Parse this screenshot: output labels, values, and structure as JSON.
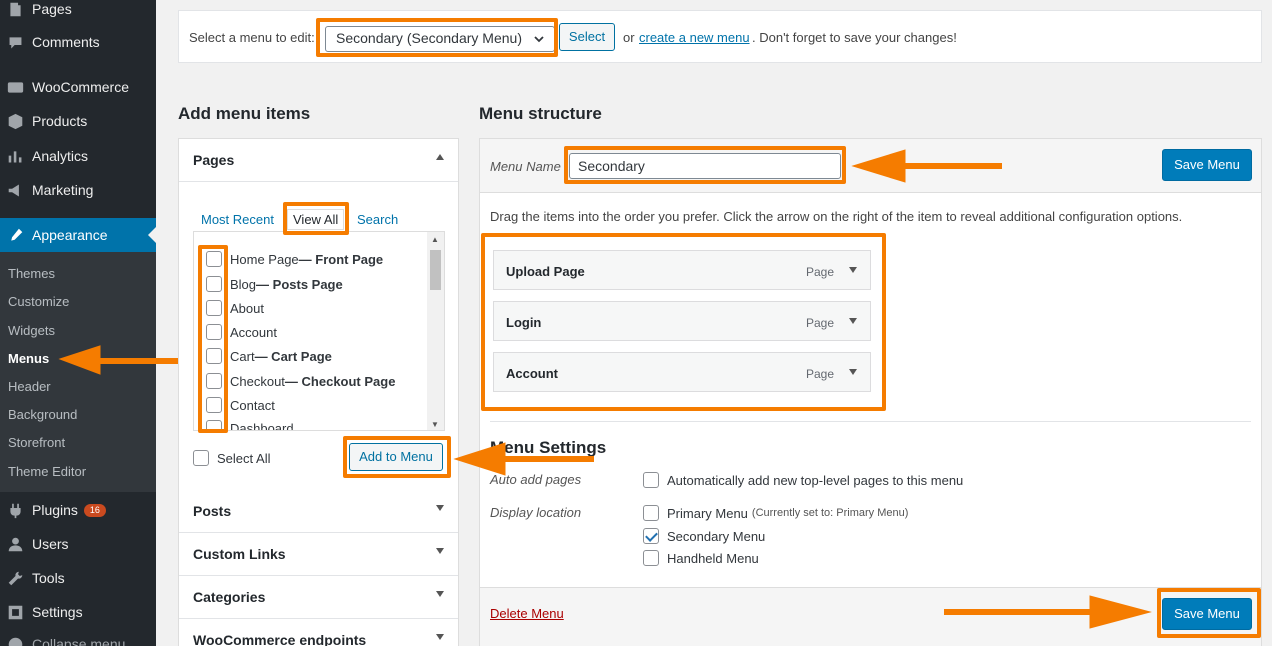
{
  "sidebar": {
    "items": [
      {
        "label": "Pages",
        "icon": "pages-icon"
      },
      {
        "label": "Comments",
        "icon": "comments-icon"
      },
      {
        "label": "WooCommerce",
        "icon": "woocommerce-icon"
      },
      {
        "label": "Products",
        "icon": "products-icon"
      },
      {
        "label": "Analytics",
        "icon": "analytics-icon"
      },
      {
        "label": "Marketing",
        "icon": "marketing-icon"
      },
      {
        "label": "Appearance",
        "icon": "appearance-icon"
      },
      {
        "label": "Plugins",
        "icon": "plugins-icon",
        "badge": "16"
      },
      {
        "label": "Users",
        "icon": "users-icon"
      },
      {
        "label": "Tools",
        "icon": "tools-icon"
      },
      {
        "label": "Settings",
        "icon": "settings-icon"
      },
      {
        "label": "Collapse menu",
        "icon": "collapse-icon"
      }
    ],
    "submenu": [
      "Themes",
      "Customize",
      "Widgets",
      "Menus",
      "Header",
      "Background",
      "Storefront",
      "Theme Editor"
    ]
  },
  "topbar": {
    "label": "Select a menu to edit:",
    "selected_menu": "Secondary (Secondary Menu)",
    "select_button": "Select",
    "or_text": "or",
    "create_link": "create a new menu",
    "rest_text": ". Don't forget to save your changes!"
  },
  "add_items": {
    "title": "Add menu items",
    "pages_header": "Pages",
    "tabs": [
      "Most Recent",
      "View All",
      "Search"
    ],
    "pages": [
      {
        "name": "Home Page",
        "suffix": " — Front Page"
      },
      {
        "name": "Blog",
        "suffix": " — Posts Page"
      },
      {
        "name": "About",
        "suffix": ""
      },
      {
        "name": "Account",
        "suffix": ""
      },
      {
        "name": "Cart",
        "suffix": " — Cart Page"
      },
      {
        "name": "Checkout",
        "suffix": " — Checkout Page"
      },
      {
        "name": "Contact",
        "suffix": ""
      },
      {
        "name": "Dashboard",
        "suffix": ""
      }
    ],
    "select_all": "Select All",
    "add_button": "Add to Menu",
    "sections": [
      "Posts",
      "Custom Links",
      "Categories",
      "WooCommerce endpoints"
    ]
  },
  "structure": {
    "title": "Menu structure",
    "menu_name_label": "Menu Name",
    "menu_name_value": "Secondary",
    "save_button": "Save Menu",
    "description": "Drag the items into the order you prefer. Click the arrow on the right of the item to reveal additional configuration options.",
    "items": [
      {
        "title": "Upload Page",
        "type": "Page"
      },
      {
        "title": "Login",
        "type": "Page"
      },
      {
        "title": "Account",
        "type": "Page"
      }
    ],
    "settings_title": "Menu Settings",
    "auto_add_label": "Auto add pages",
    "auto_add_option": "Automatically add new top-level pages to this menu",
    "display_location_label": "Display location",
    "locations": [
      {
        "label": "Primary Menu",
        "note": "(Currently set to: Primary Menu)",
        "checked": false
      },
      {
        "label": "Secondary Menu",
        "note": "",
        "checked": true
      },
      {
        "label": "Handheld Menu",
        "note": "",
        "checked": false
      }
    ],
    "delete_link": "Delete Menu"
  },
  "colors": {
    "sidebar_bg": "#23282d",
    "accent_blue": "#0073aa",
    "annotation_orange": "#f57c00"
  }
}
